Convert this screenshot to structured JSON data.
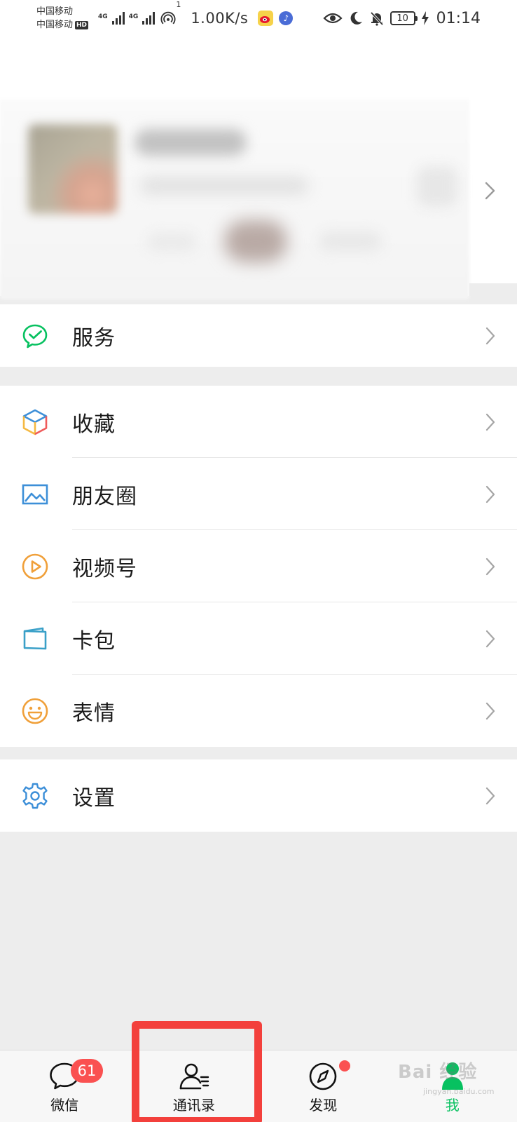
{
  "status_bar": {
    "carrier_1": "中国移动",
    "carrier_2": "中国移动",
    "hd_badge": "HD",
    "net_tag_1": "4G",
    "net_tag_2": "4G",
    "hotspot_count": "1",
    "speed": "1.00K/s",
    "battery": "10",
    "time": "01:14",
    "icons": [
      "signal-icon",
      "signal-icon",
      "hotspot-icon",
      "weibo-icon",
      "music-icon",
      "eye-icon",
      "moon-icon",
      "bell-off-icon",
      "battery-icon",
      "charging-icon"
    ]
  },
  "profile": {
    "arrow_icon": "chevron-right-icon"
  },
  "menu": {
    "group_1": [
      {
        "label": "服务",
        "icon": "service-icon",
        "color": "#07c160"
      }
    ],
    "group_2": [
      {
        "label": "收藏",
        "icon": "favorites-cube-icon",
        "color": "#3d8fd8"
      },
      {
        "label": "朋友圈",
        "icon": "moments-picture-icon",
        "color": "#3d8fd8"
      },
      {
        "label": "视频号",
        "icon": "channels-play-icon",
        "color": "#f0a03a"
      },
      {
        "label": "卡包",
        "icon": "card-wallet-icon",
        "color": "#3aa0c8"
      },
      {
        "label": "表情",
        "icon": "sticker-smile-icon",
        "color": "#f0a03a"
      }
    ],
    "group_3": [
      {
        "label": "设置",
        "icon": "settings-gear-icon",
        "color": "#3d8fd8"
      }
    ]
  },
  "bottom_nav": {
    "items": [
      {
        "label": "微信",
        "icon": "chat-bubble-icon",
        "badge": "61"
      },
      {
        "label": "通讯录",
        "icon": "contacts-icon"
      },
      {
        "label": "发现",
        "icon": "compass-icon"
      },
      {
        "label": "我",
        "icon": "me-person-icon"
      }
    ],
    "active_color": "#07c160",
    "badge_color": "#fa5151"
  },
  "watermark": {
    "text": "Bai 经验",
    "sub": "jingyan.baidu.com"
  }
}
